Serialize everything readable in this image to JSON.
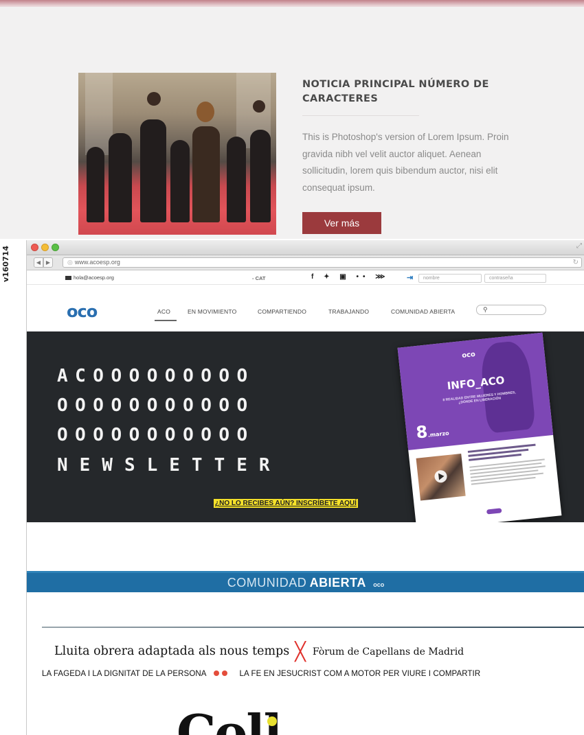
{
  "mock": {
    "title": "NOTICIA PRINCIPAL NÚMERO DE CARACTERES",
    "body": "This is Photoshop's version of Lorem Ipsum. Proin gravida nibh vel velit auctor aliquet. Aenean sollicitudin, lorem quis bibendum auctor, nisi elit consequat ipsum.",
    "button": "Ver más"
  },
  "side_code": "v160714",
  "browser": {
    "url": "www.acoesp.org",
    "utility": {
      "email": "hola@acoesp.org",
      "lang": "- CAT",
      "social_icons": [
        "facebook-icon",
        "twitter-icon",
        "youtube-icon",
        "flickr-icon",
        "rss-icon"
      ],
      "social_glyphs": "f ✦ ▣ •• ⋙",
      "user_placeholder": "nombre",
      "pass_placeholder": "contraseña"
    },
    "logo": "oco",
    "nav": [
      "ACO",
      "EN MOVIMIENTO",
      "COMPARTIENDO",
      "TRABAJANDO",
      "COMUNIDAD ABIERTA"
    ],
    "active_nav": "ACO",
    "hero": {
      "lines": [
        "ACOOOOOOOOO",
        "OOOOOOOOOOO",
        "OOOOOOOOOOO",
        "NEWSLETTER"
      ],
      "cta": "¿NO LO RECIBES AÚN? INSCRÍBETE AQUÍ",
      "magazine": {
        "logo": "oco",
        "title": "INFO_ACO",
        "subtitle": "8 REALIDAD ENTRE MUJERES Y HOMBRES, ¿DÓNDE EN LIBERACIÓN",
        "date_num": "8",
        "date_text": "marzo"
      }
    },
    "section": {
      "light": "COMUNIDAD",
      "bold": "ABIERTA",
      "mini": "oco"
    },
    "ticker1": {
      "item1": "Lluita obrera adaptada als nous temps",
      "separator": "╳",
      "item2": "Fòrum de Capellans de Madrid"
    },
    "ticker2": {
      "item1": "LA FAGEDA I LA DIGNITAT DE LA PERSONA",
      "item2": "LA FE EN JESUCRIST COM A MOTOR PER VIURE I COMPARTIR"
    },
    "big_logo": "Coll"
  },
  "colors": {
    "accent_red": "#9b3a3d",
    "brand_blue": "#1f6ea4",
    "hero_bg": "#25282b",
    "cta_yellow": "#f5e12a",
    "magazine_purple": "#7d47b5"
  }
}
